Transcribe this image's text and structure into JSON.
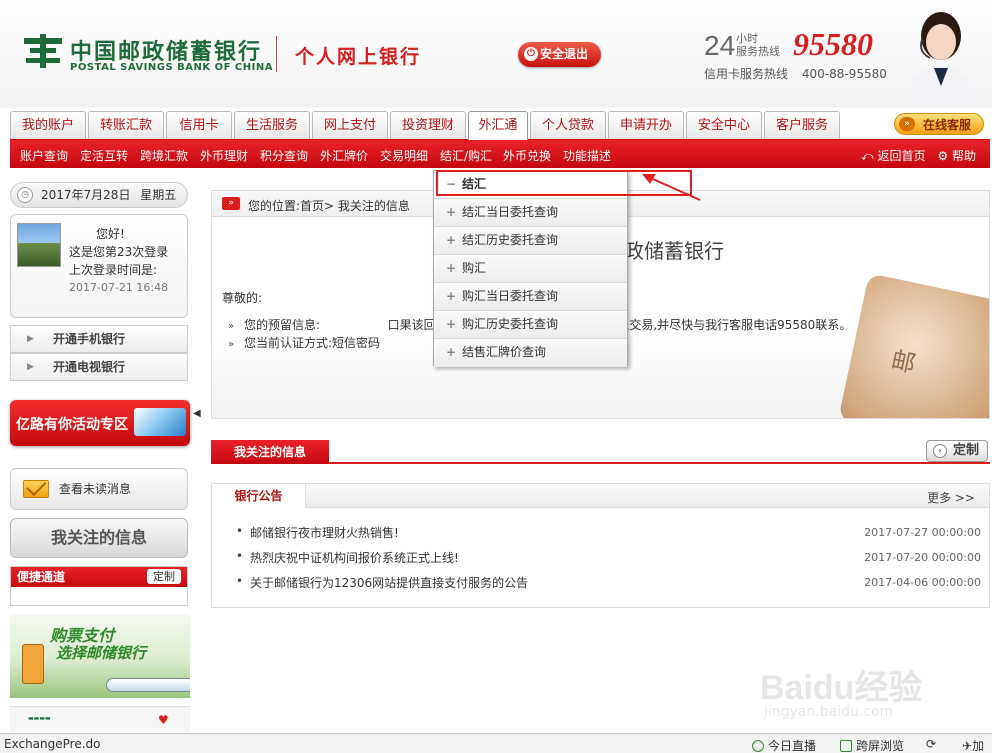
{
  "header": {
    "bank_name_cn": "中国邮政储蓄银行",
    "bank_name_en": "POSTAL SAVINGS BANK OF CHINA",
    "site_name": "个人网上银行",
    "logout_label": "安全退出",
    "hotline_24": "24",
    "hotline_hours": "小时",
    "hotline_label": "服务热线",
    "hotline_number": "95580",
    "card_hotline_label": "信用卡服务热线",
    "card_hotline_number": "400-88-95580"
  },
  "main_nav": {
    "tabs": [
      "我的账户",
      "转账汇款",
      "信用卡",
      "生活服务",
      "网上支付",
      "投资理财",
      "外汇通",
      "个人贷款",
      "申请开办",
      "安全中心",
      "客户服务"
    ],
    "active": "外汇通",
    "online_service": "在线客服"
  },
  "sub_nav": {
    "items": [
      "账户查询",
      "定活互转",
      "跨境汇款",
      "外币理财",
      "积分查询",
      "外汇牌价",
      "交易明细",
      "结汇/购汇",
      "外币兑换",
      "功能描述"
    ],
    "back_home": "返回首页",
    "help": "帮助"
  },
  "sidebar": {
    "date": "2017年7月28日",
    "weekday": "星期五",
    "greeting": "您好!",
    "login_count": "这是您第23次登录",
    "last_login_label": "上次登录时间是:",
    "last_login_time": "2017-07-21 16:48",
    "links": [
      "开通手机银行",
      "开通电视银行"
    ],
    "promo_label": "亿路有你活动专区",
    "unread_label": "查看未读消息",
    "my_focus_label": "我关注的信息",
    "quick_title": "便捷通道",
    "quick_custom": "定制",
    "promo1_line1": "购票支付",
    "promo1_line2": "选择邮储银行"
  },
  "breadcrumb": {
    "label": "您的位置:首页> 我关注的信息"
  },
  "welcome": {
    "title_fragment": "政储蓄银行",
    "dear": "尊敬的:",
    "notice1_a": "您的预留信息:",
    "notice1_b": "口果该回",
    "notice1_c": "即停止交易,并尽快与我行客服电话95580联系。",
    "notice2": "您当前认证方式:短信密码"
  },
  "dropdown": {
    "items": [
      "结汇",
      "结汇当日委托查询",
      "结汇历史委托查询",
      "购汇",
      "购汇当日委托查询",
      "购汇历史委托查询",
      "结售汇牌价查询"
    ]
  },
  "focus": {
    "tab_label": "我关注的信息",
    "custom_label": "定制"
  },
  "notices": {
    "tab_label": "银行公告",
    "more_label": "更多 >>",
    "items": [
      {
        "title": "邮储银行夜市理财火热销售!",
        "date": "2017-07-27 00:00:00"
      },
      {
        "title": "热烈庆祝中证机构间报价系统正式上线!",
        "date": "2017-07-20 00:00:00"
      },
      {
        "title": "关于邮储银行为12306网站提供直接支付服务的公告",
        "date": "2017-04-06 00:00:00"
      }
    ]
  },
  "status_bar": {
    "url": "ExchangePre.do",
    "live": "今日直播",
    "cross_screen": "跨屏浏览",
    "accelerate": "加"
  },
  "watermark": {
    "brand": "Baidu经验",
    "url": "jingyan.baidu.com"
  },
  "colors": {
    "brand_red": "#d81e1e",
    "brand_green": "#1e6b3a"
  }
}
